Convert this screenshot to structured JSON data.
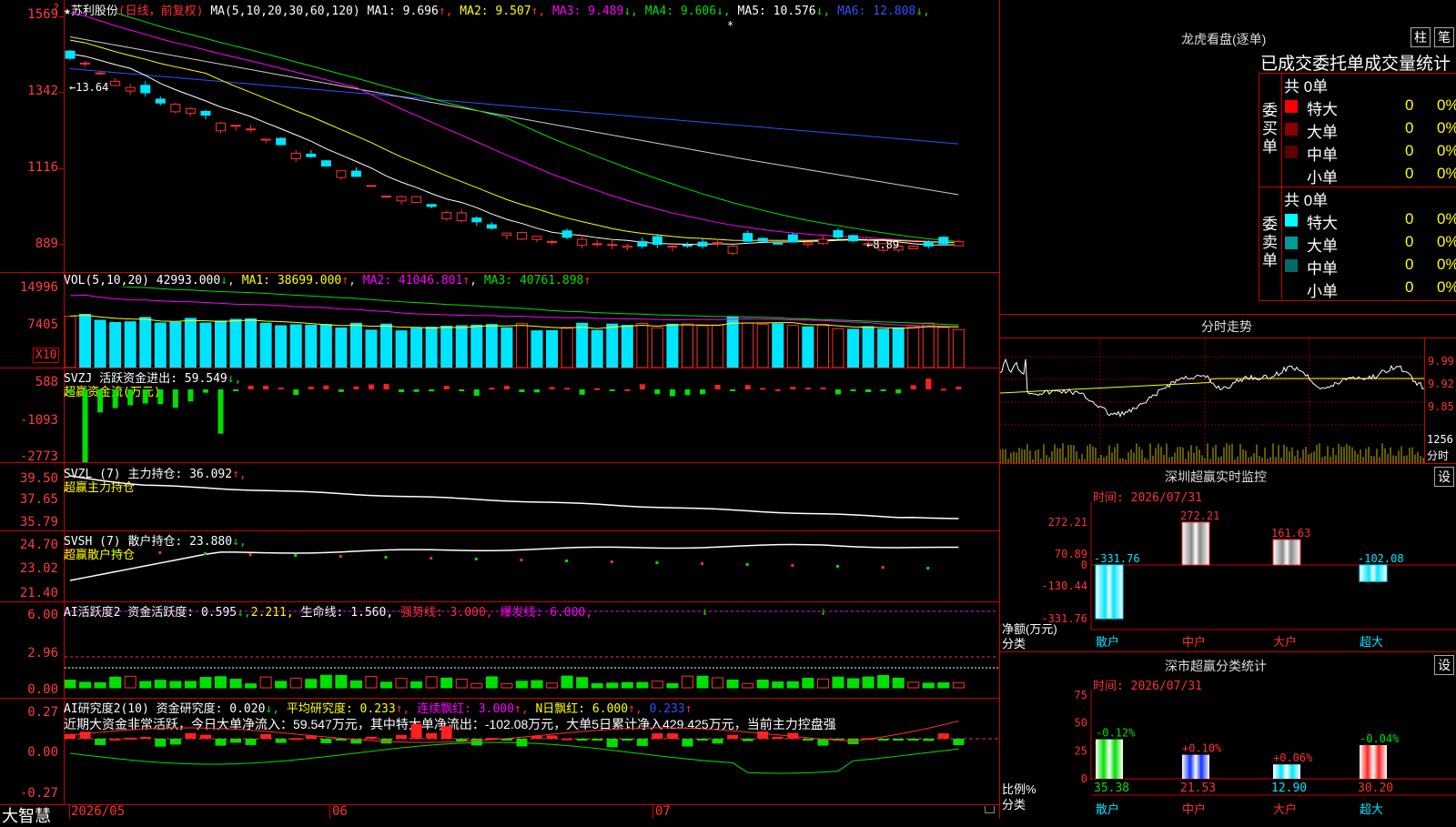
{
  "main": {
    "name": "苏利股份",
    "mode": "(日线，前复权)",
    "ma_params": "MA(5,10,20,30,60,120)",
    "ma": [
      {
        "label": "MA1: 9.696",
        "arrow": "↑",
        "color": "#ffffff",
        "arrow_color": "#ff3030"
      },
      {
        "label": "MA2: 9.507",
        "arrow": "↑",
        "color": "#ffff00",
        "arrow_color": "#ff3030"
      },
      {
        "label": "MA3: 9.489",
        "arrow": "↓",
        "color": "#ff00ff",
        "arrow_color": "#00e000"
      },
      {
        "label": "MA4: 9.606",
        "arrow": "↓",
        "color": "#00e000",
        "arrow_color": "#00e000"
      },
      {
        "label": "MA5: 10.576",
        "arrow": "↓",
        "color": "#ffffff",
        "arrow_color": "#00e000"
      },
      {
        "label": "MA6: 12.808",
        "arrow": "↓",
        "color": "#3050ff",
        "arrow_color": "#00e000"
      }
    ],
    "axis_labels": [
      "1569",
      "1342",
      "1116",
      "889"
    ],
    "high_marker": "←13.64",
    "low_marker": "←8.89",
    "corner_q": "?"
  },
  "vol": {
    "title": "VOL(5,10,20)",
    "value": "42993.000",
    "value_arrow": "↓",
    "ma1": "MA1: 38699.000",
    "ma1_arrow": "↑",
    "ma2": "MA2: 41046.801",
    "ma2_arrow": "↑",
    "ma3": "MA3: 40761.898",
    "ma3_arrow": "↑",
    "axis_labels": [
      "14996",
      "7405"
    ],
    "unit": "X10"
  },
  "svzj": {
    "title": "SVZJ  活跃资金进出: 59.549",
    "arrow": "↓,",
    "sub": "超赢资金流(万元)",
    "axis_labels": [
      "588",
      "-1093",
      "-2773"
    ]
  },
  "svzl": {
    "title": "SVZL (7) 主力持仓: 36.092",
    "arrow": "↑,",
    "sub": "超赢主力持仓",
    "axis_labels": [
      "39.50",
      "37.65",
      "35.79"
    ]
  },
  "svsh": {
    "title": "SVSH (7) 散户持仓: 23.880",
    "arrow": "↓,",
    "sub": "超赢散户持仓",
    "axis_labels": [
      "24.70",
      "23.02",
      "21.40"
    ]
  },
  "ai1": {
    "title": "AI活跃度2 资金活跃度: 0.595",
    "arrow1": "↓,",
    "v2": "2.211,",
    "life": "生命线: 1.560,",
    "strong": "强势线: 3.000,",
    "burst": "爆发线: 6.000,",
    "axis_labels": [
      "6.00",
      "2.96",
      "0.00"
    ]
  },
  "ai2": {
    "title": "AI研究度2(10) 资金研究度: 0.020",
    "arrow1": "↓,",
    "avg": "平均研究度: 0.233",
    "avg_arrow": "↑,",
    "cont": "连续飘红: 3.000",
    "cont_arrow": "↑,",
    "nday": "N日飘红: 6.000",
    "nday_arrow": "↑,",
    "last": "0.233",
    "last_arrow": "↑",
    "summary": "近期大资金非常活跃，今日大单净流入：59.547万元，其中特大单净流出：-102.08万元，大单5日累计净入429.425万元，当前主力控盘强",
    "axis_labels": [
      "0.27",
      "0.00",
      "-0.27"
    ]
  },
  "bottom": {
    "brand": "大智慧",
    "dates": [
      "2026/05",
      "06",
      "07"
    ]
  },
  "right": {
    "lhb_title": "龙虎看盘(逐单)",
    "btn_zhu": "柱",
    "btn_bi": "笔",
    "stat_title": "已成交委托单成交量统计",
    "buy": {
      "total": "共 0单",
      "side_label": "委买单",
      "rows": [
        {
          "name": "特大",
          "count": "0",
          "pct": "0%",
          "color": "#ff0000"
        },
        {
          "name": "大单",
          "count": "0",
          "pct": "0%",
          "color": "#8b0000"
        },
        {
          "name": "中单",
          "count": "0",
          "pct": "0%",
          "color": "#5a0000"
        },
        {
          "name": "小单",
          "count": "0",
          "pct": "0%",
          "color": "#000000"
        }
      ]
    },
    "sell": {
      "total": "共 0单",
      "side_label": "委卖单",
      "rows": [
        {
          "name": "特大",
          "count": "0",
          "pct": "0%",
          "color": "#00ffff"
        },
        {
          "name": "大单",
          "count": "0",
          "pct": "0%",
          "color": "#009a9a"
        },
        {
          "name": "中单",
          "count": "0",
          "pct": "0%",
          "color": "#006a6a"
        },
        {
          "name": "小单",
          "count": "0",
          "pct": "0%",
          "color": "#000000"
        }
      ]
    },
    "intraday": {
      "title": "分时走势",
      "prices": [
        "9.99",
        "9.92",
        "9.85"
      ],
      "vol": "1256",
      "vol_unit": "分时"
    },
    "monitor": {
      "title": "深圳超赢实时监控",
      "settings": "设",
      "time": "时间: 2026/07/31",
      "axis": [
        "272.21",
        "70.89",
        "0",
        "-130.44",
        "-331.76"
      ],
      "y_label1": "净额(万元)",
      "y_label2": "分类",
      "categories": [
        "散户",
        "中户",
        "大户",
        "超大"
      ],
      "values": [
        -331.76,
        272.21,
        161.63,
        -102.08
      ],
      "value_labels": [
        "-331.76",
        "272.21",
        "161.63",
        "-102.08"
      ],
      "ylim": [
        -331.76,
        272.21
      ]
    },
    "classify": {
      "title": "深市超赢分类统计",
      "settings": "设",
      "time": "时间: 2026/07/31",
      "axis": [
        "75",
        "50",
        "25",
        "0"
      ],
      "y_label1": "比例%",
      "y_label2": "分类",
      "categories": [
        "散户",
        "中户",
        "大户",
        "超大"
      ],
      "values": [
        35.38,
        21.53,
        12.9,
        30.2
      ],
      "value_labels": [
        "35.38",
        "21.53",
        "12.90",
        "30.20"
      ],
      "changes": [
        "-0.12%",
        "+0.10%",
        "+0.06%",
        "-0.04%"
      ],
      "ylim": [
        0,
        75
      ]
    }
  }
}
